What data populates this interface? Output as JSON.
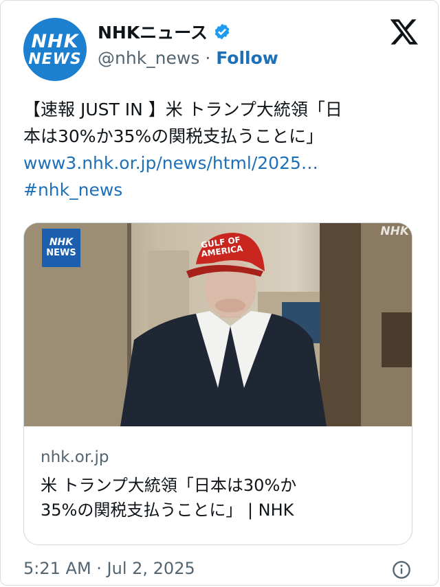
{
  "account": {
    "avatar_line1": "NHK",
    "avatar_line2": "NEWS",
    "display_name": "NHKニュース",
    "handle": "@nhk_news",
    "separator": " · ",
    "follow_label": "Follow"
  },
  "tweet": {
    "text_line1": "【速報 JUST IN 】米 トランプ大統領「日",
    "text_line2": "本は30%か35%の関税支払うことに」",
    "link": "www3.nhk.or.jp/news/html/2025…",
    "hashtag": "#nhk_news"
  },
  "card": {
    "logo_line1": "NHK",
    "logo_line2": "NEWS",
    "watermark": "NHK",
    "hat_line1": "GULF OF",
    "hat_line2": "AMERICA",
    "domain": "nhk.or.jp",
    "title_line1": "米 トランプ大統領「日本は30%か",
    "title_line2": "35%の関税支払うことに」 | NHK"
  },
  "footer": {
    "timestamp": "5:21 AM · Jul 2, 2025"
  },
  "icons": {
    "verified": "verified-badge-icon",
    "x_logo": "x-logo-icon",
    "info": "info-icon"
  },
  "colors": {
    "link": "#1d70b8",
    "avatar": "#1d7fd0",
    "verified": "#1d9bf0",
    "secondary_text": "#536471"
  }
}
